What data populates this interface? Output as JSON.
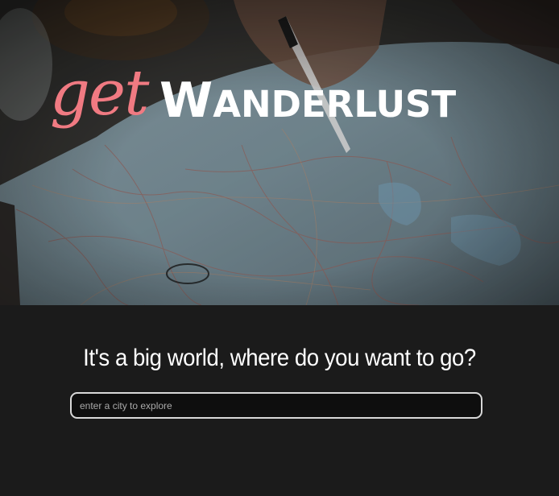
{
  "hero": {
    "logo_script": "get",
    "logo_initial": "W",
    "logo_rest": "ANDERLUST",
    "background_image": "map-with-hand-and-pen",
    "colors": {
      "script": "#f07a82",
      "word": "#ffffff"
    }
  },
  "main": {
    "heading": "It's a big world, where do you want to go?",
    "search": {
      "placeholder": "enter a city to explore",
      "value": ""
    },
    "background": "#1b1b1b"
  }
}
